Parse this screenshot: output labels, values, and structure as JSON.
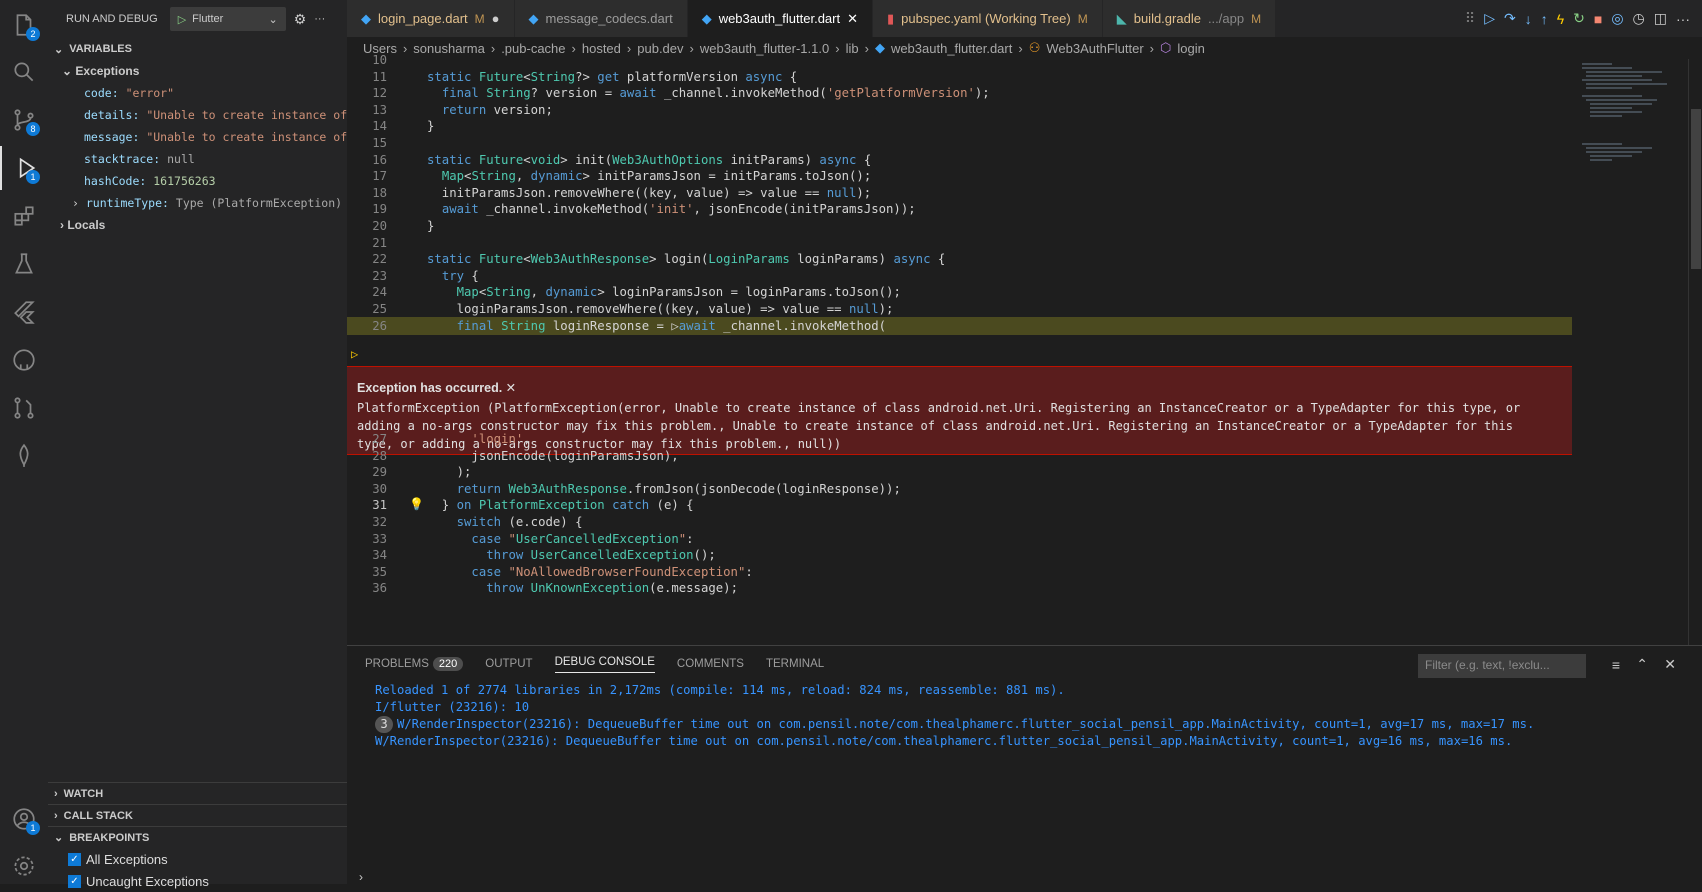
{
  "activity": {
    "explorer_badge": "2",
    "scm_badge": "8",
    "debug_badge": "1",
    "account_badge": "1"
  },
  "sidebar": {
    "title": "RUN AND DEBUG",
    "config": "Flutter",
    "variables_title": "VARIABLES",
    "exceptions_label": "Exceptions",
    "vars": [
      {
        "k": "code:",
        "v": "\"error\""
      },
      {
        "k": "details:",
        "v": "\"Unable to create instance of…"
      },
      {
        "k": "message:",
        "v": "\"Unable to create instance of…"
      },
      {
        "k": "stacktrace:",
        "v": "null"
      },
      {
        "k": "hashCode:",
        "v": "161756263"
      },
      {
        "k": "runtimeType:",
        "v": "Type (PlatformException)"
      }
    ],
    "locals_label": "Locals",
    "watch": "WATCH",
    "callstack": "CALL STACK",
    "breakpoints": "BREAKPOINTS",
    "bp_all": "All Exceptions",
    "bp_uncaught": "Uncaught Exceptions"
  },
  "tabs": [
    {
      "label": "login_page.dart",
      "mod": "M"
    },
    {
      "label": "message_codecs.dart",
      "mod": ""
    },
    {
      "label": "web3auth_flutter.dart",
      "mod": ""
    },
    {
      "label": "pubspec.yaml (Working Tree)",
      "mod": "M"
    },
    {
      "label": "build.gradle",
      "extra": ".../app",
      "mod": "M"
    }
  ],
  "breadcrumb": [
    "Users",
    "sonusharma",
    ".pub-cache",
    "hosted",
    "pub.dev",
    "web3auth_flutter-1.1.0",
    "lib",
    "web3auth_flutter.dart",
    "Web3AuthFlutter",
    "login"
  ],
  "code_top": [
    {
      "n": "10",
      "t": ""
    },
    {
      "n": "11",
      "t": "static Future<String?> get platformVersion async {"
    },
    {
      "n": "12",
      "t": "  final String? version = await _channel.invokeMethod('getPlatformVersion');"
    },
    {
      "n": "13",
      "t": "  return version;"
    },
    {
      "n": "14",
      "t": "}"
    },
    {
      "n": "15",
      "t": ""
    },
    {
      "n": "16",
      "t": "static Future<void> init(Web3AuthOptions initParams) async {"
    },
    {
      "n": "17",
      "t": "  Map<String, dynamic> initParamsJson = initParams.toJson();"
    },
    {
      "n": "18",
      "t": "  initParamsJson.removeWhere((key, value) => value == null);"
    },
    {
      "n": "19",
      "t": "  await _channel.invokeMethod('init', jsonEncode(initParamsJson));"
    },
    {
      "n": "20",
      "t": "}"
    },
    {
      "n": "21",
      "t": ""
    },
    {
      "n": "22",
      "t": "static Future<Web3AuthResponse> login(LoginParams loginParams) async {"
    },
    {
      "n": "23",
      "t": "  try {"
    },
    {
      "n": "24",
      "t": "    Map<String, dynamic> loginParamsJson = loginParams.toJson();"
    },
    {
      "n": "25",
      "t": "    loginParamsJson.removeWhere((key, value) => value == null);"
    },
    {
      "n": "26",
      "t": "    final String loginResponse = ▷await _channel.invokeMethod("
    }
  ],
  "exception": {
    "title": "Exception has occurred.",
    "line1": "PlatformException (PlatformException(error, Unable to create instance of class android.net.Uri. Registering an InstanceCreator or a TypeAdapter for this type, or",
    "line2": "adding a no-args constructor may fix this problem., Unable to create instance of class android.net.Uri. Registering an InstanceCreator or a TypeAdapter for this",
    "line3": "type, or adding a no-args constructor may fix this problem., null))"
  },
  "code_bottom": [
    {
      "n": "27",
      "t": "      'login',"
    },
    {
      "n": "28",
      "t": "      jsonEncode(loginParamsJson),"
    },
    {
      "n": "29",
      "t": "    );"
    },
    {
      "n": "30",
      "t": "    return Web3AuthResponse.fromJson(jsonDecode(loginResponse));"
    },
    {
      "n": "31",
      "t": "  } on PlatformException catch (e) {"
    },
    {
      "n": "32",
      "t": "    switch (e.code) {"
    },
    {
      "n": "33",
      "t": "      case \"UserCancelledException\":"
    },
    {
      "n": "34",
      "t": "        throw UserCancelledException();"
    },
    {
      "n": "35",
      "t": "      case \"NoAllowedBrowserFoundException\":"
    },
    {
      "n": "36",
      "t": "        throw UnKnownException(e.message);"
    }
  ],
  "panel": {
    "tabs": [
      "PROBLEMS",
      "OUTPUT",
      "DEBUG CONSOLE",
      "COMMENTS",
      "TERMINAL"
    ],
    "problems_count": "220",
    "filter_placeholder": "Filter (e.g. text, !exclu...",
    "lines": [
      "Reloaded 1 of 2774 libraries in 2,172ms (compile: 114 ms, reload: 824 ms, reassemble: 881 ms).",
      "I/flutter (23216): 10",
      "W/RenderInspector(23216): DequeueBuffer time out on com.pensil.note/com.thealphamerc.flutter_social_pensil_app.MainActivity, count=1, avg=17 ms, max=17 ms.",
      "W/RenderInspector(23216): DequeueBuffer time out on com.pensil.note/com.thealphamerc.flutter_social_pensil_app.MainActivity, count=1, avg=16 ms, max=16 ms."
    ],
    "repeat_count": "3"
  }
}
